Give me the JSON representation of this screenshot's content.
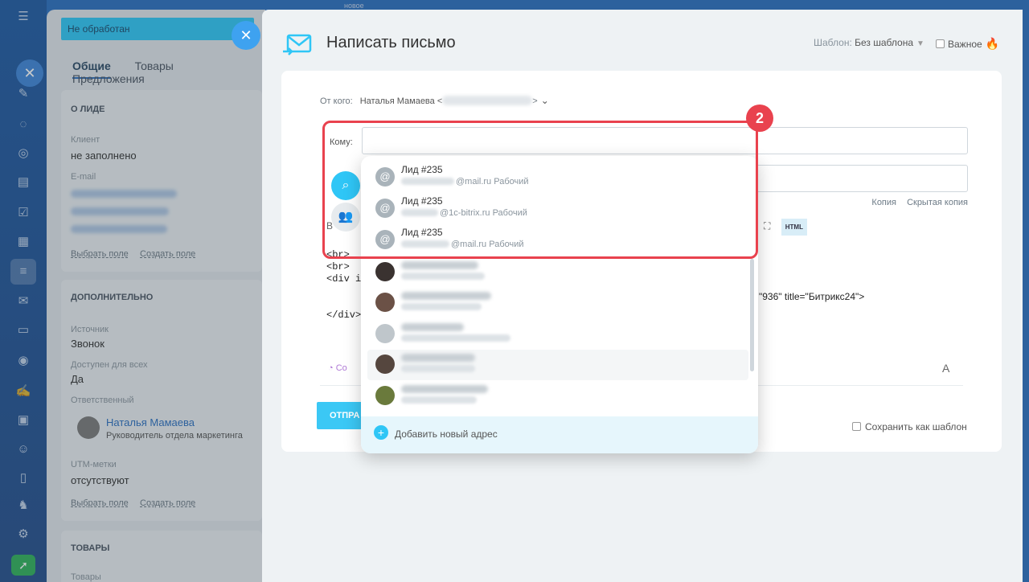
{
  "lead": {
    "status": "Не обработан",
    "tabs": [
      "Общие",
      "Товары",
      "Предложения"
    ],
    "about_header": "О ЛИДЕ",
    "client_label": "Клиент",
    "client_value": "не заполнено",
    "email_label": "E-mail",
    "select_field": "Выбрать поле",
    "create_field": "Создать поле",
    "additional_header": "ДОПОЛНИТЕЛЬНО",
    "source_label": "Источник",
    "source_value": "Звонок",
    "available_label": "Доступен для всех",
    "available_value": "Да",
    "responsible_label": "Ответственный",
    "responsible_name": "Наталья Мамаева",
    "responsible_role": "Руководитель отдела маркетинга",
    "utm_label": "UTM-метки",
    "utm_value": "отсутствуют",
    "goods_header": "ТОВАРЫ",
    "goods_label": "Товары"
  },
  "top_ghost": "новое",
  "email": {
    "title": "Написать письмо",
    "template_label": "Шаблон:",
    "template_value": "Без шаблона",
    "important_label": "Важное",
    "from_label": "От кого:",
    "from_name": "Наталья Мамаева <",
    "from_close": ">",
    "to_label": "Кому:",
    "copy": "Копия",
    "hidden_copy": "Скрытая копия",
    "toolbar_b": "B",
    "html_btn": "HTML",
    "code_lines": "<br>\n<br>\n<div id=\n      --<\n      <in\n</div>",
    "code_right": "\"936\" title=\"Битрикс24\">",
    "copilot": "Co",
    "font_btn": "A",
    "send_btn": "ОТПРА",
    "save_template": "Сохранить как шаблон"
  },
  "dropdown": {
    "items": [
      {
        "name": "Лид #235",
        "domain": "@mail.ru",
        "type": "Рабочий"
      },
      {
        "name": "Лид #235",
        "domain": "@1c-bitrix.ru",
        "type": "Рабочий"
      },
      {
        "name": "Лид #235",
        "domain": "@mail.ru",
        "type": "Рабочий"
      }
    ],
    "add_address": "Добавить новый адрес"
  },
  "annotation": {
    "step": "2"
  },
  "colors": {
    "accent": "#2fc6f6",
    "highlight": "#e9424e",
    "sidebar": "#1f5aa3"
  }
}
